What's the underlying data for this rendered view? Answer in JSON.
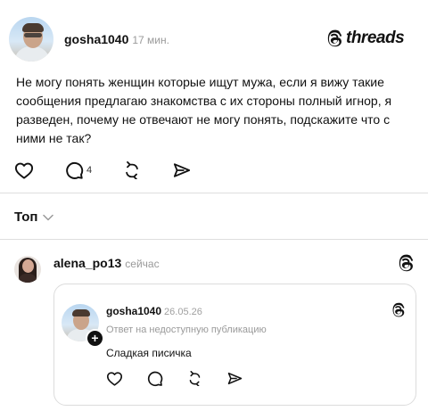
{
  "post": {
    "author": "gosha1040",
    "time": "17 мин.",
    "text": "Не могу понять женщин которые ищут мужа, если я вижу такие сообщения предлагаю знакомства с их стороны полный игнор, я разведен, почему не отвечают не могу понять, подскажите что с ними не так?",
    "reply_count": "4"
  },
  "brand": {
    "logo_text": "threads"
  },
  "sort": {
    "label": "Топ"
  },
  "reply": {
    "author": "alena_po13",
    "time": "сейчас",
    "quote": {
      "author": "gosha1040",
      "date": "26.05.26",
      "subtitle": "Ответ на недоступную публикацию",
      "text": "Сладкая писичка"
    }
  },
  "icons": [
    "heart-icon",
    "comment-icon",
    "repost-icon",
    "share-icon",
    "threads-logo-icon",
    "chevron-down-icon",
    "plus-icon"
  ],
  "colors": {
    "text": "#111111",
    "muted": "#9a9a9a",
    "divider": "#dedede"
  }
}
